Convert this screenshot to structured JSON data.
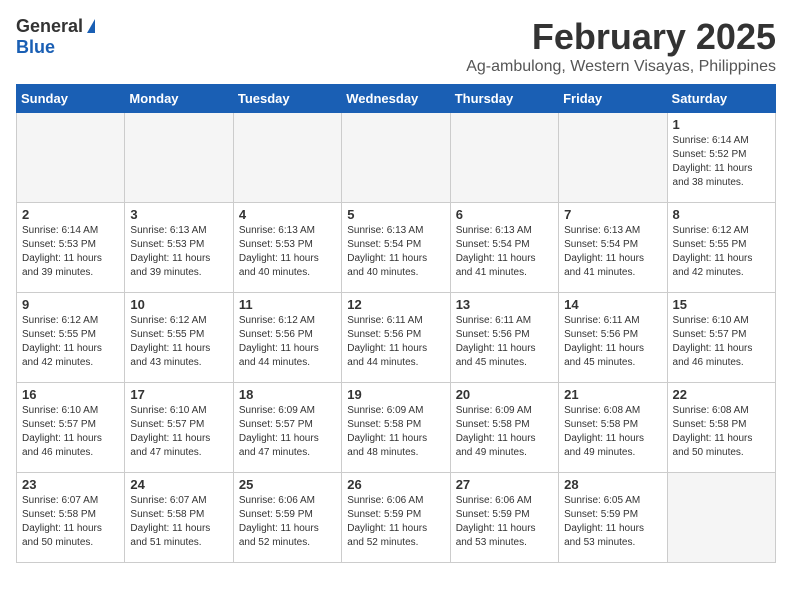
{
  "header": {
    "logo_general": "General",
    "logo_blue": "Blue",
    "title": "February 2025",
    "subtitle": "Ag-ambulong, Western Visayas, Philippines"
  },
  "days_of_week": [
    "Sunday",
    "Monday",
    "Tuesday",
    "Wednesday",
    "Thursday",
    "Friday",
    "Saturday"
  ],
  "weeks": [
    [
      {
        "day": "",
        "info": ""
      },
      {
        "day": "",
        "info": ""
      },
      {
        "day": "",
        "info": ""
      },
      {
        "day": "",
        "info": ""
      },
      {
        "day": "",
        "info": ""
      },
      {
        "day": "",
        "info": ""
      },
      {
        "day": "1",
        "info": "Sunrise: 6:14 AM\nSunset: 5:52 PM\nDaylight: 11 hours\nand 38 minutes."
      }
    ],
    [
      {
        "day": "2",
        "info": "Sunrise: 6:14 AM\nSunset: 5:53 PM\nDaylight: 11 hours\nand 39 minutes."
      },
      {
        "day": "3",
        "info": "Sunrise: 6:13 AM\nSunset: 5:53 PM\nDaylight: 11 hours\nand 39 minutes."
      },
      {
        "day": "4",
        "info": "Sunrise: 6:13 AM\nSunset: 5:53 PM\nDaylight: 11 hours\nand 40 minutes."
      },
      {
        "day": "5",
        "info": "Sunrise: 6:13 AM\nSunset: 5:54 PM\nDaylight: 11 hours\nand 40 minutes."
      },
      {
        "day": "6",
        "info": "Sunrise: 6:13 AM\nSunset: 5:54 PM\nDaylight: 11 hours\nand 41 minutes."
      },
      {
        "day": "7",
        "info": "Sunrise: 6:13 AM\nSunset: 5:54 PM\nDaylight: 11 hours\nand 41 minutes."
      },
      {
        "day": "8",
        "info": "Sunrise: 6:12 AM\nSunset: 5:55 PM\nDaylight: 11 hours\nand 42 minutes."
      }
    ],
    [
      {
        "day": "9",
        "info": "Sunrise: 6:12 AM\nSunset: 5:55 PM\nDaylight: 11 hours\nand 42 minutes."
      },
      {
        "day": "10",
        "info": "Sunrise: 6:12 AM\nSunset: 5:55 PM\nDaylight: 11 hours\nand 43 minutes."
      },
      {
        "day": "11",
        "info": "Sunrise: 6:12 AM\nSunset: 5:56 PM\nDaylight: 11 hours\nand 44 minutes."
      },
      {
        "day": "12",
        "info": "Sunrise: 6:11 AM\nSunset: 5:56 PM\nDaylight: 11 hours\nand 44 minutes."
      },
      {
        "day": "13",
        "info": "Sunrise: 6:11 AM\nSunset: 5:56 PM\nDaylight: 11 hours\nand 45 minutes."
      },
      {
        "day": "14",
        "info": "Sunrise: 6:11 AM\nSunset: 5:56 PM\nDaylight: 11 hours\nand 45 minutes."
      },
      {
        "day": "15",
        "info": "Sunrise: 6:10 AM\nSunset: 5:57 PM\nDaylight: 11 hours\nand 46 minutes."
      }
    ],
    [
      {
        "day": "16",
        "info": "Sunrise: 6:10 AM\nSunset: 5:57 PM\nDaylight: 11 hours\nand 46 minutes."
      },
      {
        "day": "17",
        "info": "Sunrise: 6:10 AM\nSunset: 5:57 PM\nDaylight: 11 hours\nand 47 minutes."
      },
      {
        "day": "18",
        "info": "Sunrise: 6:09 AM\nSunset: 5:57 PM\nDaylight: 11 hours\nand 47 minutes."
      },
      {
        "day": "19",
        "info": "Sunrise: 6:09 AM\nSunset: 5:58 PM\nDaylight: 11 hours\nand 48 minutes."
      },
      {
        "day": "20",
        "info": "Sunrise: 6:09 AM\nSunset: 5:58 PM\nDaylight: 11 hours\nand 49 minutes."
      },
      {
        "day": "21",
        "info": "Sunrise: 6:08 AM\nSunset: 5:58 PM\nDaylight: 11 hours\nand 49 minutes."
      },
      {
        "day": "22",
        "info": "Sunrise: 6:08 AM\nSunset: 5:58 PM\nDaylight: 11 hours\nand 50 minutes."
      }
    ],
    [
      {
        "day": "23",
        "info": "Sunrise: 6:07 AM\nSunset: 5:58 PM\nDaylight: 11 hours\nand 50 minutes."
      },
      {
        "day": "24",
        "info": "Sunrise: 6:07 AM\nSunset: 5:58 PM\nDaylight: 11 hours\nand 51 minutes."
      },
      {
        "day": "25",
        "info": "Sunrise: 6:06 AM\nSunset: 5:59 PM\nDaylight: 11 hours\nand 52 minutes."
      },
      {
        "day": "26",
        "info": "Sunrise: 6:06 AM\nSunset: 5:59 PM\nDaylight: 11 hours\nand 52 minutes."
      },
      {
        "day": "27",
        "info": "Sunrise: 6:06 AM\nSunset: 5:59 PM\nDaylight: 11 hours\nand 53 minutes."
      },
      {
        "day": "28",
        "info": "Sunrise: 6:05 AM\nSunset: 5:59 PM\nDaylight: 11 hours\nand 53 minutes."
      },
      {
        "day": "",
        "info": ""
      }
    ]
  ]
}
